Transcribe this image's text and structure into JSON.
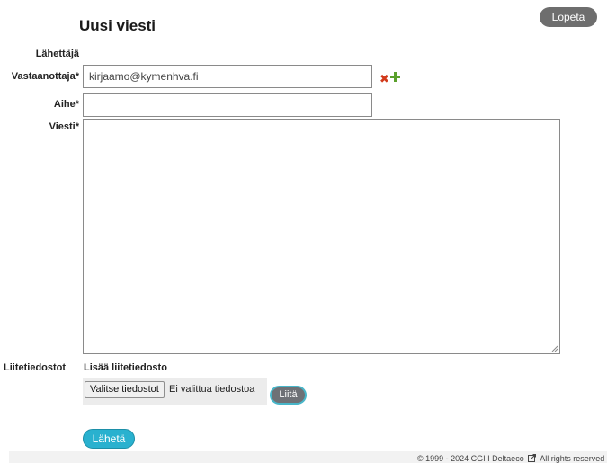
{
  "header": {
    "title": "Uusi viesti",
    "logout_label": "Lopeta"
  },
  "form": {
    "sender_label": "Lähettäjä",
    "recipient_label": "Vastaanottaja*",
    "recipient_value": "kirjaamo@kymenhva.fi",
    "subject_label": "Aihe*",
    "subject_value": "",
    "message_label": "Viesti*",
    "message_value": "",
    "recipient_icons": [
      "remove-icon",
      "add-icon"
    ]
  },
  "attachments": {
    "label": "Liitetiedostot",
    "add_label": "Lisää liitetiedosto",
    "choose_files_label": "Valitse tiedostot",
    "file_status": "Ei valittua tiedostoa",
    "attach_label": "Liitä"
  },
  "actions": {
    "send_label": "Lähetä"
  },
  "footer": {
    "left": "© 1999 - 2024 CGI I Deltaeco",
    "right": "All rights reserved"
  },
  "colors": {
    "send_button": "#29b1cf",
    "logout_button": "#6e6e6e",
    "remove_icon": "#d23a1b",
    "add_icon": "#5aa02c"
  }
}
